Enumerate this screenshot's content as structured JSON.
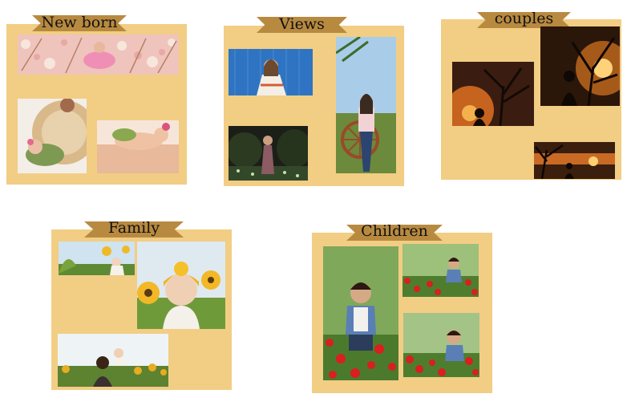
{
  "colors": {
    "card_background": "#f2cd84",
    "ribbon": "#b88a40",
    "page_background": "#ffffff"
  },
  "galleries": {
    "newborn": {
      "title": "New born",
      "photos": [
        "floral-newborn-banner",
        "newborn-wicker-basket",
        "newborn-lying-down"
      ]
    },
    "views": {
      "title": "Views",
      "photos": [
        "woman-blue-wall",
        "woman-night-garden",
        "woman-with-wagon-wheel"
      ]
    },
    "couples": {
      "title": "couples",
      "photos": [
        "silhouette-sunset-tree",
        "silhouette-golden-sun",
        "silhouette-horizon"
      ]
    },
    "family": {
      "title": "Family",
      "photos": [
        "baby-sunflowers-small",
        "baby-yellow-turban-sunflowers",
        "mother-child-sunflower-field"
      ]
    },
    "children": {
      "title": "Children",
      "photos": [
        "boy-red-poppies-large",
        "boy-poppies-top",
        "boy-poppies-bottom"
      ]
    }
  }
}
